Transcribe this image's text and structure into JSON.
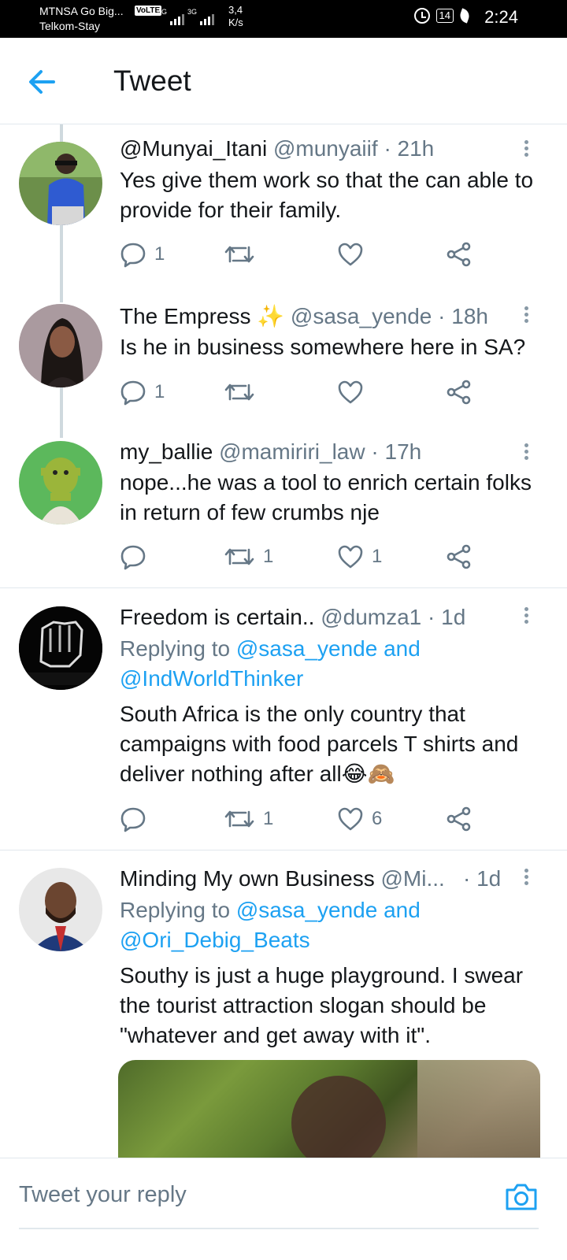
{
  "status_bar": {
    "carrier_1": "MTNSA Go Big...",
    "carrier_2": "Telkom-Stay",
    "volte": "VoLTE",
    "net_1": "4G",
    "net_2": "3G",
    "speed_value": "3,4",
    "speed_unit": "K/s",
    "battery": "14",
    "time": "2:24"
  },
  "header": {
    "title": "Tweet",
    "back_icon": "arrow-left-icon"
  },
  "tweets": [
    {
      "name": "@Munyai_Itani",
      "handle": "@munyaiif",
      "time": "· 21h",
      "text": "Yes give them work so that the can able to provide for their family.",
      "reply_count": "1",
      "retweet_count": "",
      "like_count": ""
    },
    {
      "name": "The Empress ✨",
      "handle": "@sasa_yende",
      "time": "· 18h",
      "text": "Is he in business somewhere here in SA?",
      "reply_count": "1",
      "retweet_count": "",
      "like_count": ""
    },
    {
      "name": "my_ballie",
      "handle": "@mamiriri_law",
      "time": "· 17h",
      "text": "nope...he was a tool to enrich certain folks in return of few crumbs nje",
      "reply_count": "",
      "retweet_count": "1",
      "like_count": "1"
    },
    {
      "name": "Freedom is certain..",
      "handle": "@dumza1",
      "time": "· 1d",
      "replying_prefix": "Replying to",
      "replying_link_1": "@sasa_yende",
      "replying_and": "and",
      "replying_link_2": "@IndWorldThinker",
      "text": "South Africa is the only country that campaigns with food parcels T shirts and deliver nothing after all😂🙈",
      "reply_count": "",
      "retweet_count": "1",
      "like_count": "6"
    },
    {
      "name": "Minding My own Business",
      "handle": "@Mi...",
      "time": "· 1d",
      "replying_prefix": "Replying to",
      "replying_link_1": "@sasa_yende",
      "replying_and": "and",
      "replying_link_2": "@Ori_Debig_Beats",
      "text": "Southy is just a huge playground. I swear the tourist attraction slogan should be \"whatever and get away with it\".",
      "reply_count": "",
      "retweet_count": "",
      "like_count": ""
    }
  ],
  "composer": {
    "placeholder": "Tweet your reply",
    "camera_icon": "camera-icon"
  },
  "colors": {
    "accent": "#1da1f2",
    "secondary_text": "#657786",
    "primary_text": "#14171a",
    "divider": "#e1e8ed",
    "thread_line": "#cfd9de"
  }
}
